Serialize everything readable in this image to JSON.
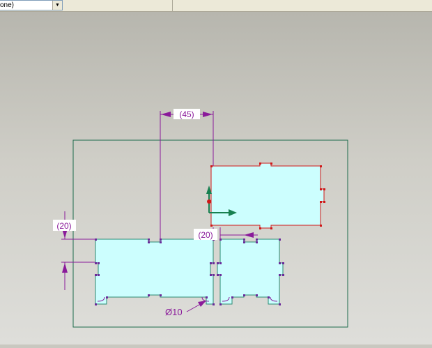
{
  "toolbar": {
    "filter_value": "one)"
  },
  "icons": {
    "dropdown": "triangle-down"
  },
  "colors": {
    "dimension": "#8a1a9a",
    "sketch_fill": "#ccfefe",
    "boundary": "#1d6b4c",
    "selected_edge": "#d01818",
    "sketch_edge": "#2a8a72",
    "csys_axis": "#178050"
  },
  "dimensions": {
    "horizontal_gap": "(45)",
    "vertical_offset": "(20)",
    "horizontal_offset": "(20)",
    "hole_diameter": "Ø10"
  }
}
